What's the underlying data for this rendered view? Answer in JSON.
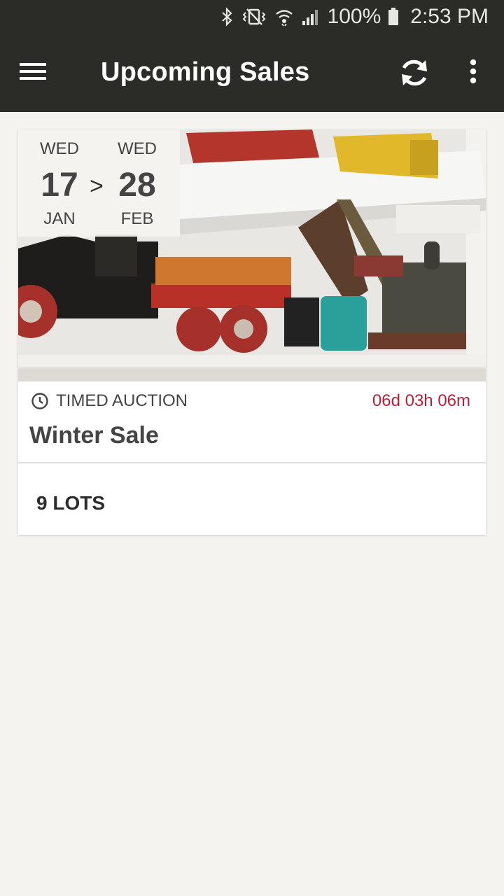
{
  "status_bar": {
    "battery": "100%",
    "time": "2:53 PM",
    "icons": [
      "bluetooth-icon",
      "vibrate-icon",
      "wifi-icon",
      "signal-icon",
      "battery-icon"
    ]
  },
  "app_bar": {
    "title": "Upcoming Sales",
    "icons": [
      "menu-icon",
      "refresh-icon",
      "more-vert-icon"
    ]
  },
  "sales": [
    {
      "start": {
        "dow": "WED",
        "day": "17",
        "month": "JAN"
      },
      "separator": ">",
      "end": {
        "dow": "WED",
        "day": "28",
        "month": "FEB"
      },
      "type": "TIMED AUCTION",
      "countdown": "06d 03h 06m",
      "title": "Winter Sale",
      "lots": "9 LOTS"
    }
  ],
  "colors": {
    "bar_background": "#2b2b27",
    "page_background": "#f4f3f0",
    "countdown_red": "#b8203a"
  }
}
